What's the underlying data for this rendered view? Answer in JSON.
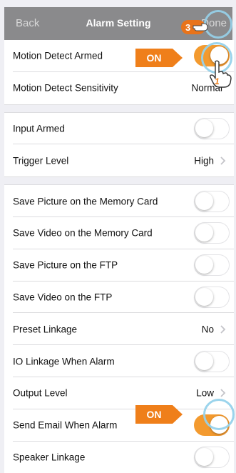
{
  "navbar": {
    "back_label": "Back",
    "title": "Alarm Setting",
    "done_label": "Done",
    "step_badge": "3"
  },
  "rows": [
    {
      "label": "Motion Detect Armed",
      "type": "toggle",
      "on": true
    },
    {
      "label": "Motion Detect Sensitivity",
      "type": "value",
      "value": "Normal"
    },
    {
      "label": "Input Armed",
      "type": "toggle",
      "on": false
    },
    {
      "label": "Trigger Level",
      "type": "value",
      "value": "High"
    },
    {
      "label": "Save Picture on the Memory Card",
      "type": "toggle",
      "on": false
    },
    {
      "label": "Save Video on the Memory Card",
      "type": "toggle",
      "on": false
    },
    {
      "label": "Save Picture on the FTP",
      "type": "toggle",
      "on": false
    },
    {
      "label": "Save Video on the FTP",
      "type": "toggle",
      "on": false
    },
    {
      "label": "Preset Linkage",
      "type": "value",
      "value": "No"
    },
    {
      "label": "IO Linkage When Alarm",
      "type": "toggle",
      "on": false
    },
    {
      "label": "Output Level",
      "type": "value",
      "value": "Low"
    },
    {
      "label": "Send Email When Alarm",
      "type": "toggle",
      "on": true
    },
    {
      "label": "Speaker Linkage",
      "type": "toggle",
      "on": false
    }
  ],
  "callouts": {
    "motion_on": "ON",
    "email_on": "ON",
    "step1_badge": "1"
  },
  "colors": {
    "accent": "#f39a2f",
    "callout": "#ef7f1a",
    "navbar": "#8a8a8c",
    "ring": "#96d2eb"
  }
}
